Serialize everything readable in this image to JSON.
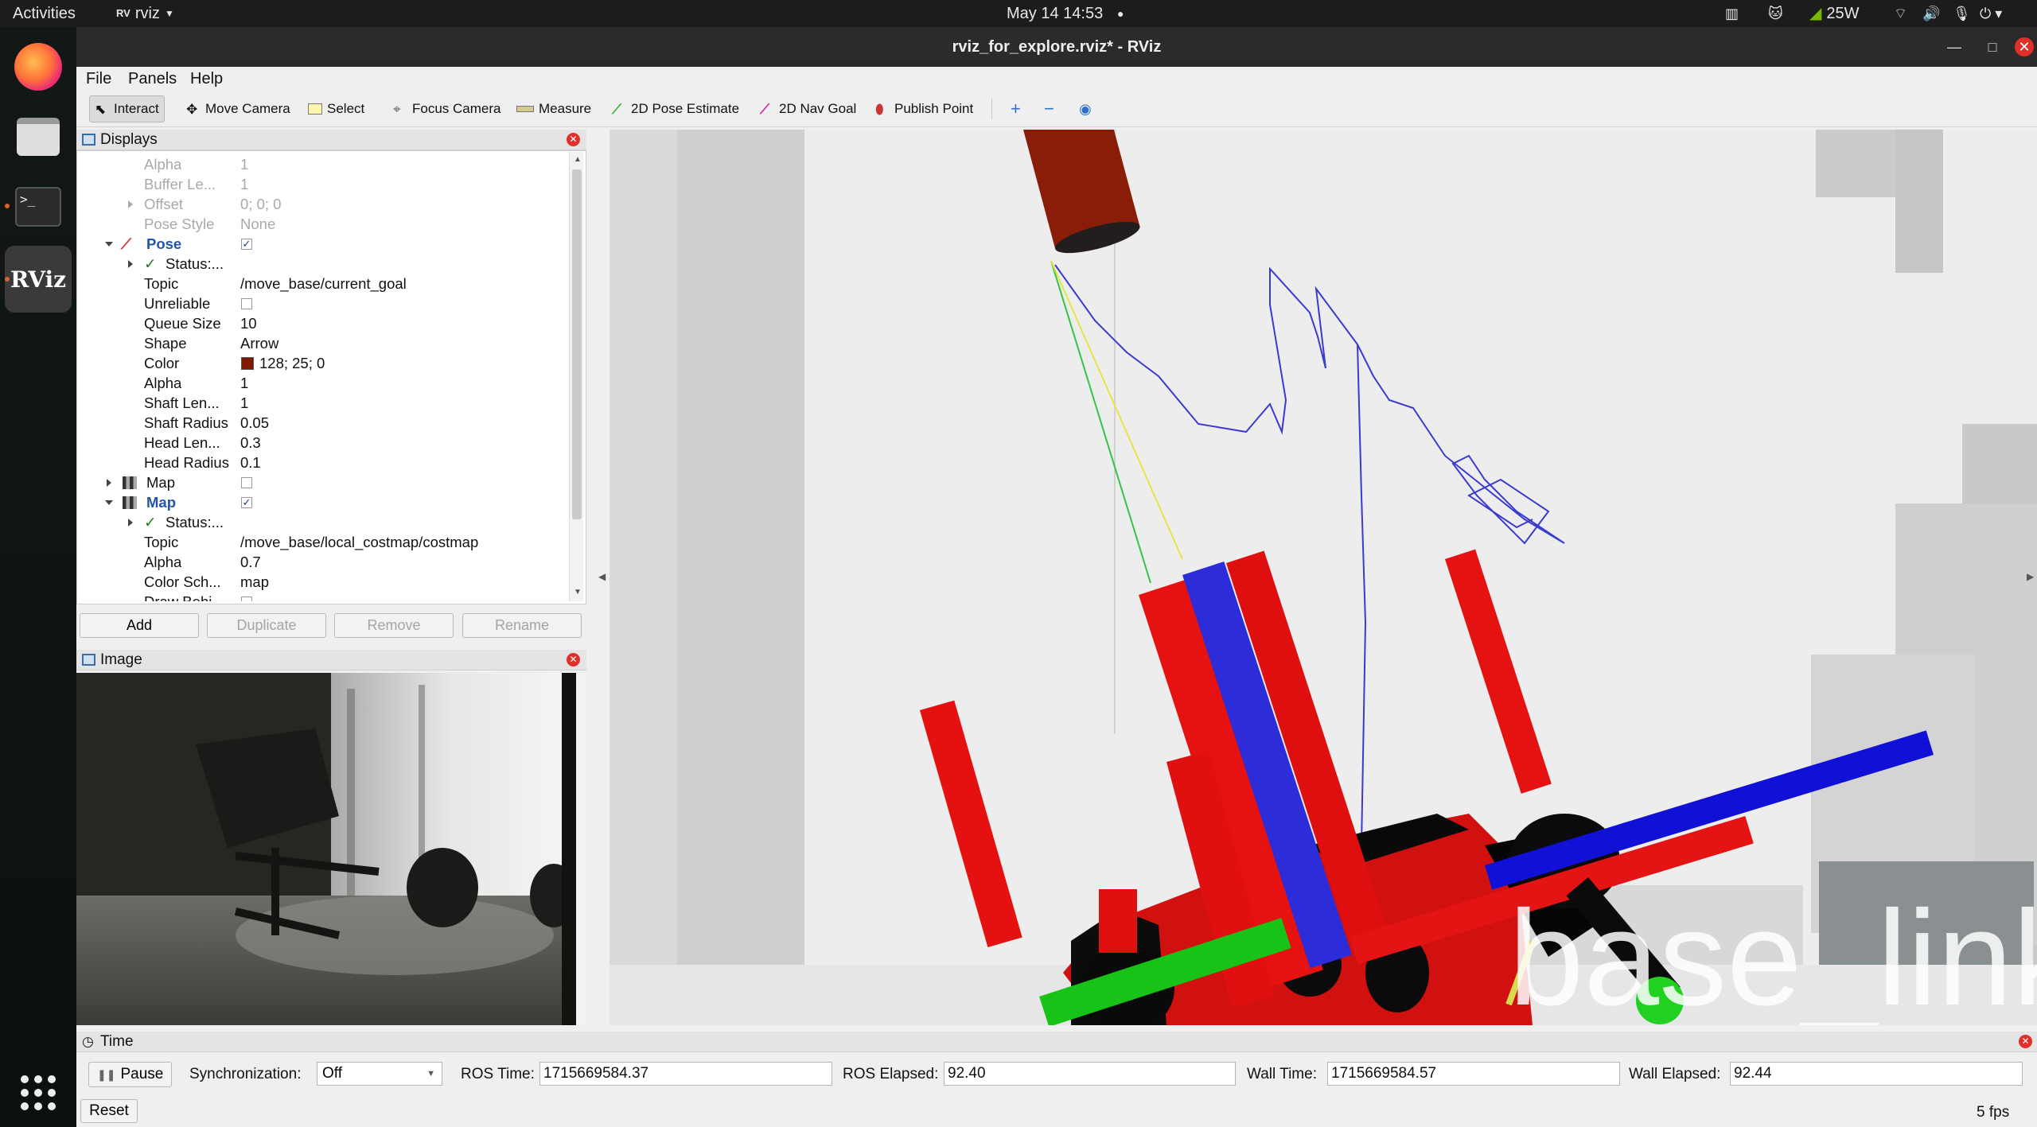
{
  "topbar": {
    "activities": "Activities",
    "app_menu": "rviz",
    "clock": "May 14  14:53",
    "power": "25W"
  },
  "window": {
    "title": "rviz_for_explore.rviz* - RViz"
  },
  "menu": {
    "file": "File",
    "panels": "Panels",
    "help": "Help"
  },
  "toolbar": {
    "interact": "Interact",
    "move_camera": "Move Camera",
    "select": "Select",
    "focus_camera": "Focus Camera",
    "measure": "Measure",
    "pose_estimate": "2D Pose Estimate",
    "nav_goal": "2D Nav Goal",
    "publish_point": "Publish Point"
  },
  "displays": {
    "title": "Displays",
    "rows": {
      "alpha_top": {
        "name": "Alpha",
        "value": "1"
      },
      "buffer": {
        "name": "Buffer Le...",
        "value": "1"
      },
      "offset": {
        "name": "Offset",
        "value": "0; 0; 0"
      },
      "pose_style": {
        "name": "Pose Style",
        "value": "None"
      },
      "pose": {
        "name": "Pose"
      },
      "pose_status": {
        "name": "Status:..."
      },
      "topic": {
        "name": "Topic",
        "value": "/move_base/current_goal"
      },
      "unreliable": {
        "name": "Unreliable"
      },
      "queue": {
        "name": "Queue Size",
        "value": "10"
      },
      "shape": {
        "name": "Shape",
        "value": "Arrow"
      },
      "color": {
        "name": "Color",
        "value": "128; 25; 0"
      },
      "alpha": {
        "name": "Alpha",
        "value": "1"
      },
      "shaft_len": {
        "name": "Shaft Len...",
        "value": "1"
      },
      "shaft_radius": {
        "name": "Shaft Radius",
        "value": "0.05"
      },
      "head_len": {
        "name": "Head Len...",
        "value": "0.3"
      },
      "head_radius": {
        "name": "Head Radius",
        "value": "0.1"
      },
      "map1": {
        "name": "Map"
      },
      "map2": {
        "name": "Map"
      },
      "map_status": {
        "name": "Status:..."
      },
      "map_topic": {
        "name": "Topic",
        "value": "/move_base/local_costmap/costmap"
      },
      "map_alpha": {
        "name": "Alpha",
        "value": "0.7"
      },
      "color_scheme": {
        "name": "Color Sch...",
        "value": "map"
      },
      "draw_behind": {
        "name": "Draw Behi..."
      }
    },
    "buttons": {
      "add": "Add",
      "duplicate": "Duplicate",
      "remove": "Remove",
      "rename": "Rename"
    }
  },
  "image_panel": {
    "title": "Image"
  },
  "viewport": {
    "overlay_text": "base_link"
  },
  "time_panel": {
    "title": "Time",
    "pause": "Pause",
    "sync_label": "Synchronization:",
    "sync_value": "Off",
    "ros_time_label": "ROS Time:",
    "ros_time": "1715669584.37",
    "ros_elapsed_label": "ROS Elapsed:",
    "ros_elapsed": "92.40",
    "wall_time_label": "Wall Time:",
    "wall_time": "1715669584.57",
    "wall_elapsed_label": "Wall Elapsed:",
    "wall_elapsed": "92.44",
    "reset": "Reset",
    "fps": "5 fps"
  },
  "colors": {
    "pose_color": "#801900",
    "accent": "#3a6ea5"
  }
}
